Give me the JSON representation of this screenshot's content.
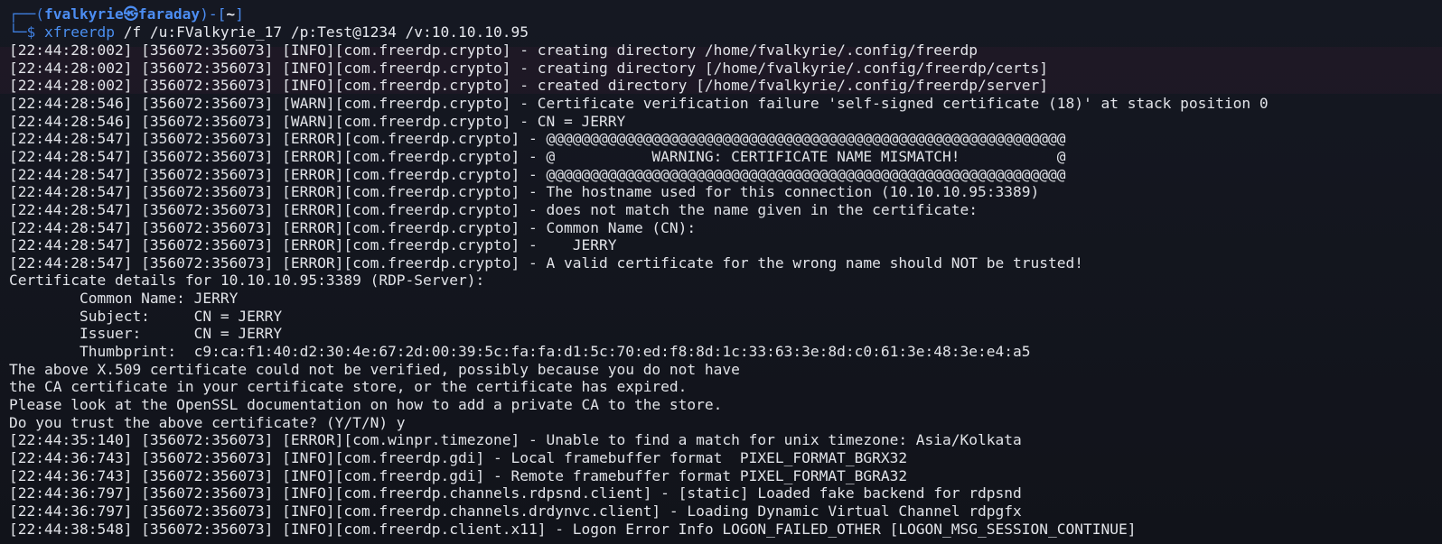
{
  "prompt": {
    "prefix": "┌──(",
    "user": "fvalkyrie",
    "sep": "㉿",
    "host": "faraday",
    "close": ")-[",
    "cwd": "~",
    "close2": "]",
    "cmd_prefix": "└─$ ",
    "command": "xfreerdp",
    "args": " /f /u:FValkyrie_17 /p:Test@1234 /v:10.10.10.95"
  },
  "output": [
    "[22:44:28:002] [356072:356073] [INFO][com.freerdp.crypto] - creating directory /home/fvalkyrie/.config/freerdp",
    "[22:44:28:002] [356072:356073] [INFO][com.freerdp.crypto] - creating directory [/home/fvalkyrie/.config/freerdp/certs]",
    "[22:44:28:002] [356072:356073] [INFO][com.freerdp.crypto] - created directory [/home/fvalkyrie/.config/freerdp/server]",
    "[22:44:28:546] [356072:356073] [WARN][com.freerdp.crypto] - Certificate verification failure 'self-signed certificate (18)' at stack position 0",
    "[22:44:28:546] [356072:356073] [WARN][com.freerdp.crypto] - CN = JERRY",
    "[22:44:28:547] [356072:356073] [ERROR][com.freerdp.crypto] - @@@@@@@@@@@@@@@@@@@@@@@@@@@@@@@@@@@@@@@@@@@@@@@@@@@@@@@@@@@",
    "[22:44:28:547] [356072:356073] [ERROR][com.freerdp.crypto] - @           WARNING: CERTIFICATE NAME MISMATCH!           @",
    "[22:44:28:547] [356072:356073] [ERROR][com.freerdp.crypto] - @@@@@@@@@@@@@@@@@@@@@@@@@@@@@@@@@@@@@@@@@@@@@@@@@@@@@@@@@@@",
    "[22:44:28:547] [356072:356073] [ERROR][com.freerdp.crypto] - The hostname used for this connection (10.10.10.95:3389)",
    "[22:44:28:547] [356072:356073] [ERROR][com.freerdp.crypto] - does not match the name given in the certificate:",
    "[22:44:28:547] [356072:356073] [ERROR][com.freerdp.crypto] - Common Name (CN):",
    "[22:44:28:547] [356072:356073] [ERROR][com.freerdp.crypto] -    JERRY",
    "[22:44:28:547] [356072:356073] [ERROR][com.freerdp.crypto] - A valid certificate for the wrong name should NOT be trusted!",
    "Certificate details for 10.10.10.95:3389 (RDP-Server):",
    "        Common Name: JERRY",
    "        Subject:     CN = JERRY",
    "        Issuer:      CN = JERRY",
    "        Thumbprint:  c9:ca:f1:40:d2:30:4e:67:2d:00:39:5c:fa:fa:d1:5c:70:ed:f8:8d:1c:33:63:3e:8d:c0:61:3e:48:3e:e4:a5",
    "The above X.509 certificate could not be verified, possibly because you do not have",
    "the CA certificate in your certificate store, or the certificate has expired.",
    "Please look at the OpenSSL documentation on how to add a private CA to the store.",
    "Do you trust the above certificate? (Y/T/N) y",
    "[22:44:35:140] [356072:356073] [ERROR][com.winpr.timezone] - Unable to find a match for unix timezone: Asia/Kolkata",
    "[22:44:36:743] [356072:356073] [INFO][com.freerdp.gdi] - Local framebuffer format  PIXEL_FORMAT_BGRX32",
    "[22:44:36:743] [356072:356073] [INFO][com.freerdp.gdi] - Remote framebuffer format PIXEL_FORMAT_BGRA32",
    "[22:44:36:797] [356072:356073] [INFO][com.freerdp.channels.rdpsnd.client] - [static] Loaded fake backend for rdpsnd",
    "[22:44:36:797] [356072:356073] [INFO][com.freerdp.channels.drdynvc.client] - Loading Dynamic Virtual Channel rdpgfx",
    "[22:44:38:548] [356072:356073] [INFO][com.freerdp.client.x11] - Logon Error Info LOGON_FAILED_OTHER [LOGON_MSG_SESSION_CONTINUE]"
  ]
}
